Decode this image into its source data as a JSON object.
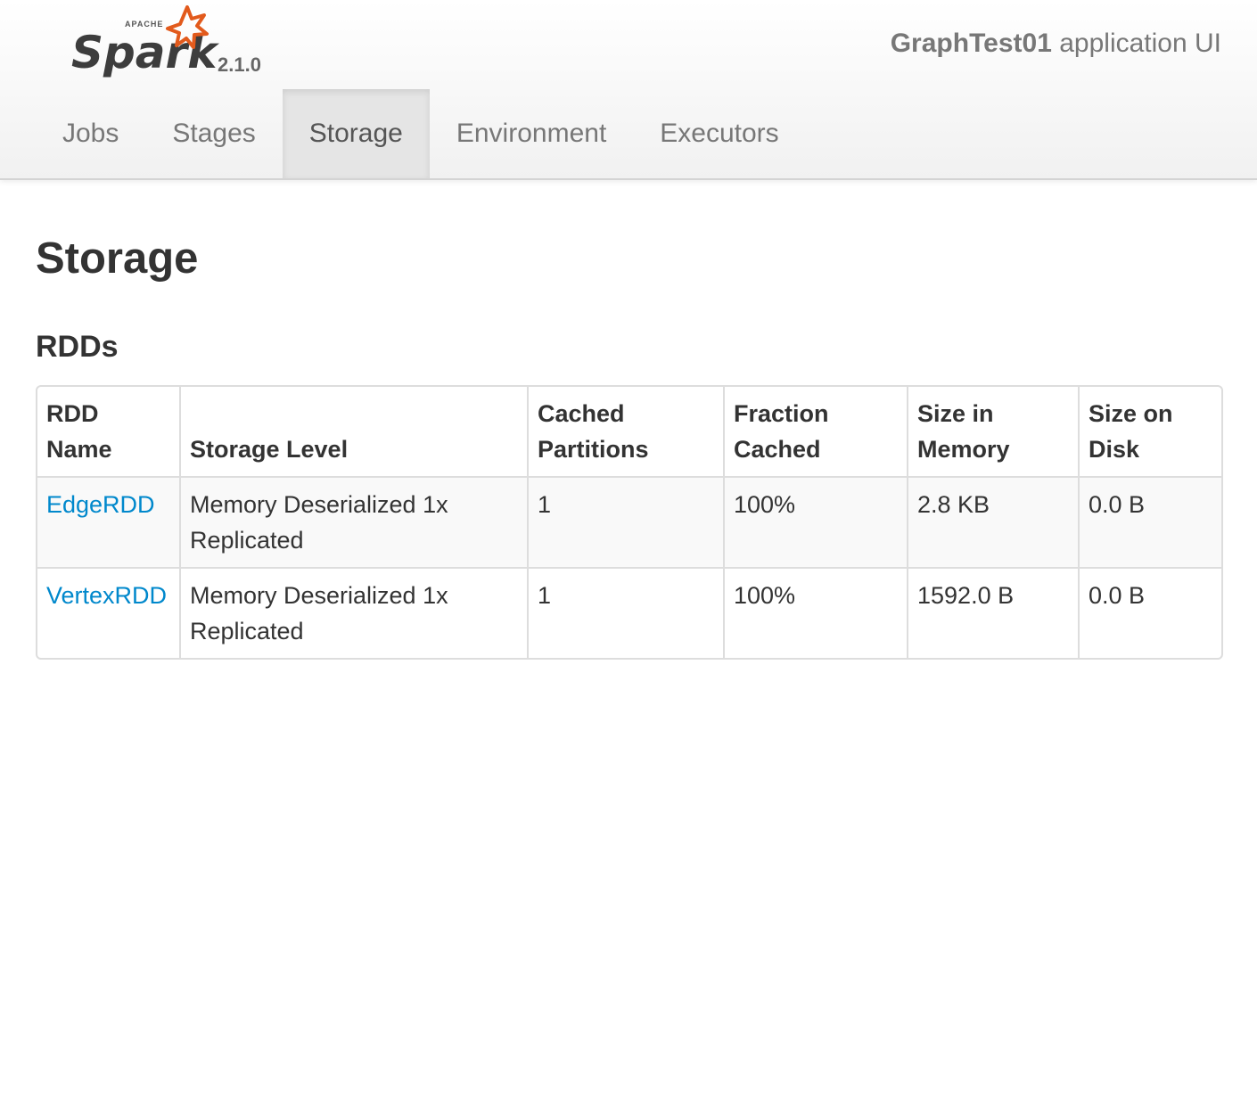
{
  "header": {
    "logo_text": "Spark",
    "logo_small_text": "APACHE",
    "version": "2.1.0",
    "app_name": "GraphTest01",
    "app_suffix": " application UI",
    "brand_star_color": "#e25a1c"
  },
  "nav": {
    "tabs": [
      {
        "label": "Jobs",
        "active": false
      },
      {
        "label": "Stages",
        "active": false
      },
      {
        "label": "Storage",
        "active": true
      },
      {
        "label": "Environment",
        "active": false
      },
      {
        "label": "Executors",
        "active": false
      }
    ]
  },
  "page": {
    "title": "Storage",
    "section_title": "RDDs"
  },
  "table": {
    "headers": {
      "rdd_name": [
        "RDD",
        "Name"
      ],
      "storage_level": [
        "",
        "Storage Level"
      ],
      "cached_partitions": [
        "Cached",
        "Partitions"
      ],
      "fraction_cached": [
        "Fraction",
        "Cached"
      ],
      "size_in_memory": [
        "Size in",
        "Memory"
      ],
      "size_on_disk": [
        "Size on",
        "Disk"
      ]
    },
    "rows": [
      {
        "rdd_name": "EdgeRDD",
        "storage_level": [
          "Memory Deserialized 1x",
          "Replicated"
        ],
        "cached_partitions": "1",
        "fraction_cached": "100%",
        "size_in_memory": "2.8 KB",
        "size_on_disk": "0.0 B"
      },
      {
        "rdd_name": "VertexRDD",
        "storage_level": [
          "Memory Deserialized 1x",
          "Replicated"
        ],
        "cached_partitions": "1",
        "fraction_cached": "100%",
        "size_in_memory": "1592.0 B",
        "size_on_disk": "0.0 B"
      }
    ]
  },
  "colors": {
    "link": "#0088cc",
    "nav_text": "#777777",
    "active_tab_bg": "#e5e5e5"
  }
}
